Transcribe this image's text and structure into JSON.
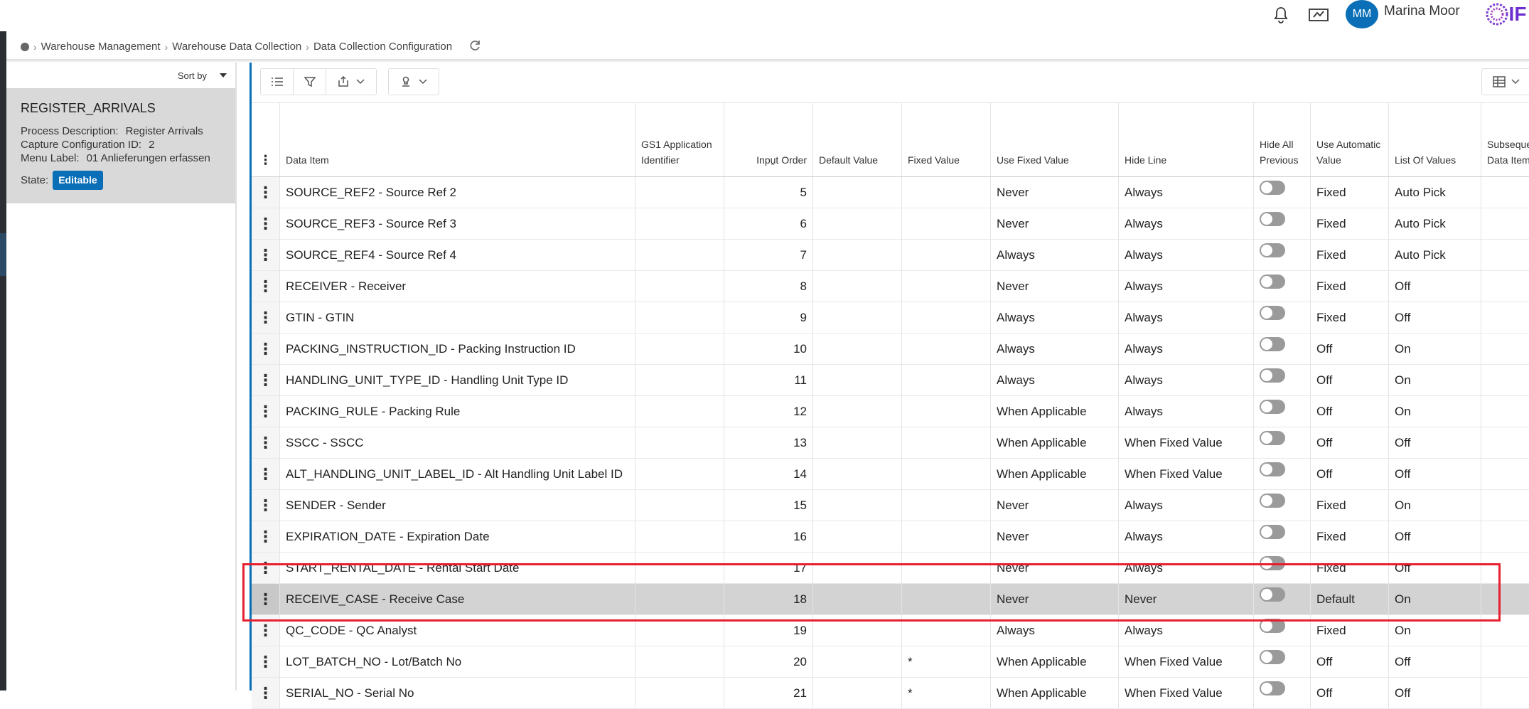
{
  "topbar": {
    "user_initials": "MM",
    "user_name": "Marina Moor",
    "logo_text": "IF"
  },
  "breadcrumb": {
    "items": [
      "Warehouse Management",
      "Warehouse Data Collection",
      "Data Collection Configuration"
    ]
  },
  "sidebar": {
    "sort_label": "Sort by",
    "card": {
      "title": "REGISTER_ARRIVALS",
      "process_description_label": "Process Description:",
      "process_description_value": "Register Arrivals",
      "capture_config_label": "Capture Configuration ID:",
      "capture_config_value": "2",
      "menu_label_label": "Menu Label:",
      "menu_label_value": "01 Anlieferungen erfassen",
      "state_label": "State:",
      "state_value": "Editable"
    }
  },
  "grid": {
    "headers": {
      "data_item": "Data Item",
      "gs1": "GS1 Application Identifier",
      "input_order": "Input Order",
      "default_value": "Default Value",
      "fixed_value": "Fixed Value",
      "use_fixed_value": "Use Fixed Value",
      "hide_line": "Hide Line",
      "hide_all_previous": "Hide All Previous",
      "use_automatic_value": "Use Automatic Value",
      "list_of_values": "List Of Values",
      "subsequent": "Subseque Data Item"
    },
    "rows": [
      {
        "item": "SOURCE_REF2 - Source Ref 2",
        "order": "5",
        "fixed": "",
        "use_fixed": "Never",
        "hide_line": "Always",
        "auto": "Fixed",
        "lov": "Auto Pick"
      },
      {
        "item": "SOURCE_REF3 - Source Ref 3",
        "order": "6",
        "fixed": "",
        "use_fixed": "Never",
        "hide_line": "Always",
        "auto": "Fixed",
        "lov": "Auto Pick"
      },
      {
        "item": "SOURCE_REF4 - Source Ref 4",
        "order": "7",
        "fixed": "",
        "use_fixed": "Always",
        "hide_line": "Always",
        "auto": "Fixed",
        "lov": "Auto Pick"
      },
      {
        "item": "RECEIVER - Receiver",
        "order": "8",
        "fixed": "",
        "use_fixed": "Never",
        "hide_line": "Always",
        "auto": "Fixed",
        "lov": "Off"
      },
      {
        "item": "GTIN - GTIN",
        "order": "9",
        "fixed": "",
        "use_fixed": "Always",
        "hide_line": "Always",
        "auto": "Fixed",
        "lov": "Off"
      },
      {
        "item": "PACKING_INSTRUCTION_ID - Packing Instruction ID",
        "order": "10",
        "fixed": "",
        "use_fixed": "Always",
        "hide_line": "Always",
        "auto": "Off",
        "lov": "On"
      },
      {
        "item": "HANDLING_UNIT_TYPE_ID - Handling Unit Type ID",
        "order": "11",
        "fixed": "",
        "use_fixed": "Always",
        "hide_line": "Always",
        "auto": "Off",
        "lov": "On"
      },
      {
        "item": "PACKING_RULE - Packing Rule",
        "order": "12",
        "fixed": "",
        "use_fixed": "When Applicable",
        "hide_line": "Always",
        "auto": "Off",
        "lov": "On"
      },
      {
        "item": "SSCC - SSCC",
        "order": "13",
        "fixed": "",
        "use_fixed": "When Applicable",
        "hide_line": "When Fixed Value",
        "auto": "Off",
        "lov": "Off"
      },
      {
        "item": "ALT_HANDLING_UNIT_LABEL_ID - Alt Handling Unit Label ID",
        "order": "14",
        "fixed": "",
        "use_fixed": "When Applicable",
        "hide_line": "When Fixed Value",
        "auto": "Off",
        "lov": "Off"
      },
      {
        "item": "SENDER - Sender",
        "order": "15",
        "fixed": "",
        "use_fixed": "Never",
        "hide_line": "Always",
        "auto": "Fixed",
        "lov": "On"
      },
      {
        "item": "EXPIRATION_DATE - Expiration Date",
        "order": "16",
        "fixed": "",
        "use_fixed": "Never",
        "hide_line": "Always",
        "auto": "Fixed",
        "lov": "Off"
      },
      {
        "item": "START_RENTAL_DATE - Rental Start Date",
        "order": "17",
        "fixed": "",
        "use_fixed": "Never",
        "hide_line": "Always",
        "auto": "Fixed",
        "lov": "Off"
      },
      {
        "item": "RECEIVE_CASE - Receive Case",
        "order": "18",
        "fixed": "",
        "use_fixed": "Never",
        "hide_line": "Never",
        "auto": "Default",
        "lov": "On",
        "selected": true
      },
      {
        "item": "QC_CODE - QC Analyst",
        "order": "19",
        "fixed": "",
        "use_fixed": "Always",
        "hide_line": "Always",
        "auto": "Fixed",
        "lov": "On"
      },
      {
        "item": "LOT_BATCH_NO - Lot/Batch No",
        "order": "20",
        "fixed": "*",
        "use_fixed": "When Applicable",
        "hide_line": "When Fixed Value",
        "auto": "Off",
        "lov": "Off"
      },
      {
        "item": "SERIAL_NO - Serial No",
        "order": "21",
        "fixed": "*",
        "use_fixed": "When Applicable",
        "hide_line": "When Fixed Value",
        "auto": "Off",
        "lov": "Off"
      }
    ]
  }
}
